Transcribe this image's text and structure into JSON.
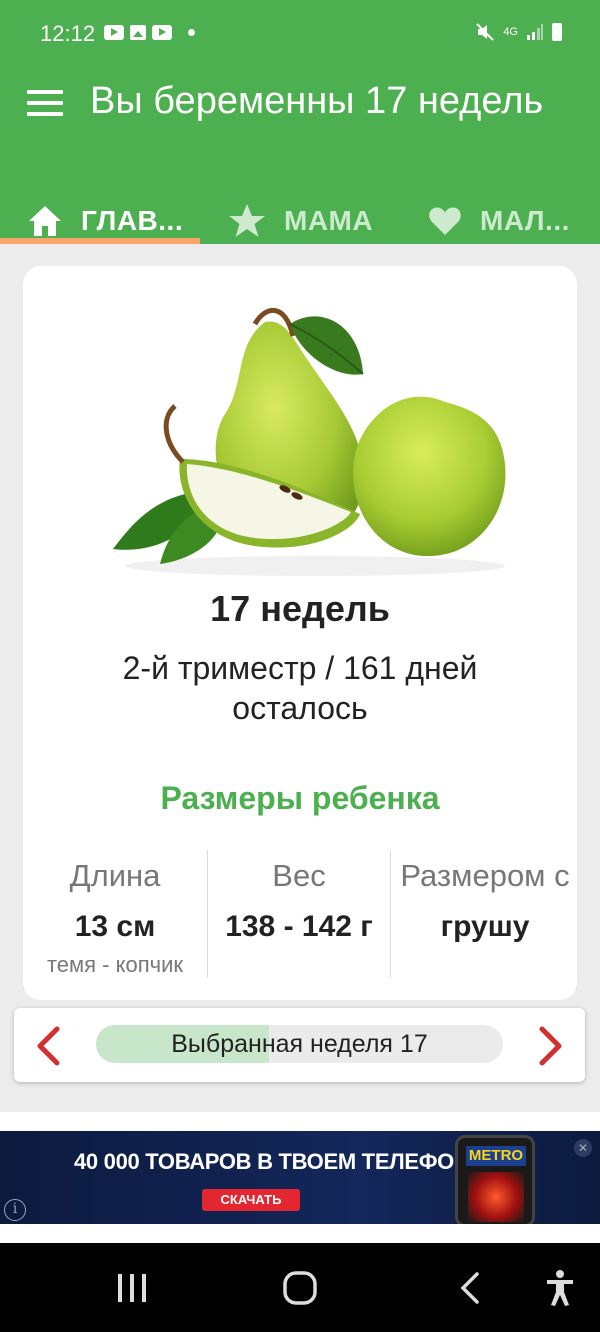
{
  "status_bar": {
    "time": "12:12",
    "network": "4G"
  },
  "app_bar": {
    "title": "Вы беременны 17 недель",
    "background": "#4caf50"
  },
  "tabs": [
    {
      "label": "ГЛАВ...",
      "icon": "home-icon",
      "selected": true
    },
    {
      "label": "МАМА",
      "icon": "star-icon",
      "selected": false
    },
    {
      "label": "МАЛ...",
      "icon": "heart-icon",
      "selected": false
    }
  ],
  "card": {
    "image": "pear-fruit-image",
    "week_title": "17 недель",
    "trimester_text": "2-й триместр / 161 дней осталось",
    "sizes_heading": "Размеры ребенка",
    "stats": [
      {
        "label": "Длина",
        "value": "13 см",
        "sub": "темя - копчик"
      },
      {
        "label": "Вес",
        "value": "138 - 142 г",
        "sub": ""
      },
      {
        "label": "Размером с",
        "value": "грушу",
        "sub": ""
      }
    ]
  },
  "week_selector": {
    "label": "Выбранная неделя 17",
    "progress": 0.425,
    "arrow_color": "#d32f2f"
  },
  "ad": {
    "headline": "40 000 ТОВАРОВ В ТВОЕМ ТЕЛЕФОНЕ",
    "cta": "СКАЧАТЬ",
    "brand": "METRO"
  }
}
